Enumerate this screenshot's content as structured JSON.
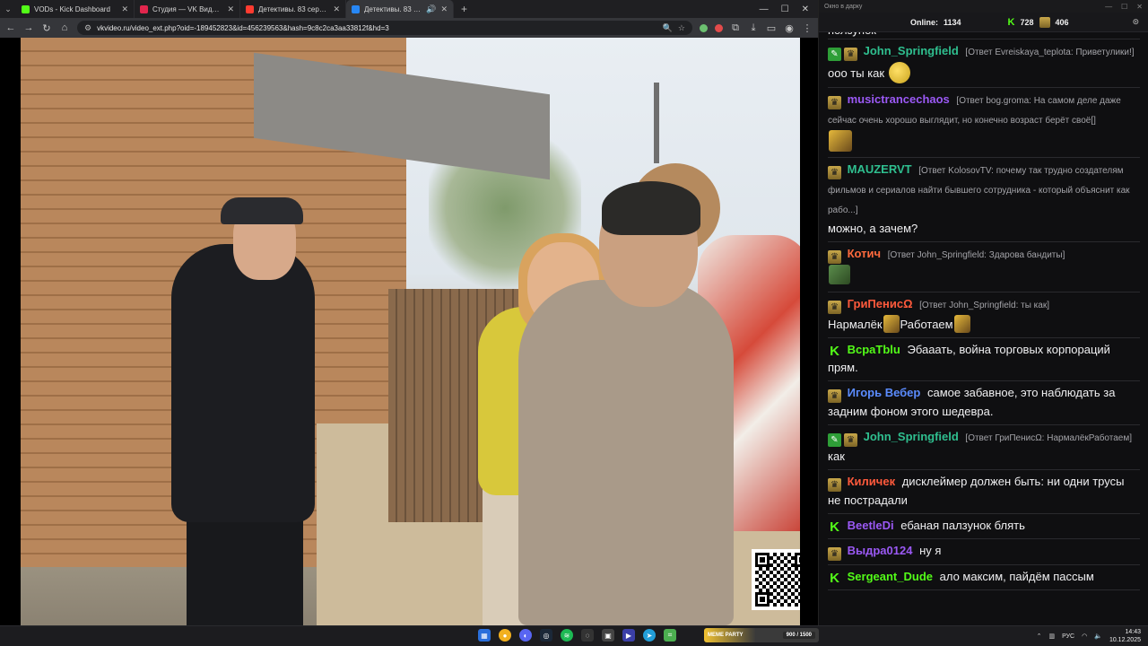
{
  "browser": {
    "tabs": [
      {
        "title": "VODs - Kick Dashboard",
        "color": "#53fc18"
      },
      {
        "title": "Студия — VK Видео Live",
        "color": "#e2264d"
      },
      {
        "title": "Детективы. 83 серия. Мужско...",
        "color": "#ff3b30"
      },
      {
        "title": "Детективы. 83 серия. Мужс",
        "color": "#2787f5"
      }
    ],
    "url": "vkvideo.ru/video_ext.php?oid=-189452823&id=456239563&hash=9c8c2ca3aa33812f&hd=3"
  },
  "chat": {
    "window_title": "Окно в дарку",
    "online_label": "Online:",
    "online_value": "1134",
    "kick_count": "728",
    "vk_count": "406",
    "partial_top": "ползунок",
    "messages": [
      {
        "user": "John_Springfield",
        "color": "#2fbf8f",
        "badges": [
          "pencil",
          "gold"
        ],
        "reply": "[Ответ Evreiskaya_teplota: Приветулики!]",
        "text": "ооо ты как",
        "emote": "face"
      },
      {
        "user": "musictrancechaos",
        "color": "#9b59f5",
        "badges": [
          "gold"
        ],
        "reply": "[Ответ bog.groma: На самом деле даже сейчас очень хорошо выглядит, но конечно возраст берёт своё[]",
        "text": "",
        "emote": "gold-line"
      },
      {
        "user": "MAUZERVT",
        "color": "#2fbf8f",
        "badges": [
          "gold"
        ],
        "reply": "[Ответ KolosovTV: почему так трудно создателям фильмов и сериалов найти бывшего сотрудника - который объяснит как рабо...]",
        "text": "можно, а зачем?",
        "emote": ""
      },
      {
        "user": "Котич",
        "color": "#ff6a3d",
        "badges": [
          "gold"
        ],
        "reply": "[Ответ John_Springfield: Здарова бандиты]",
        "text": "",
        "emote": "green-line"
      },
      {
        "user": "ГриПенисΩ",
        "color": "#ff5a3c",
        "badges": [
          "gold"
        ],
        "reply": "[Ответ John_Springfield: ты как]",
        "text_a": "Нармалёк",
        "text_b": "Работаем",
        "emote": "inline2"
      },
      {
        "user": "ВсраТblu",
        "color": "#53fc18",
        "badges": [
          "k"
        ],
        "reply": "",
        "text": "Эбааать, война торговых корпораций прям.",
        "emote": ""
      },
      {
        "user": "Игорь Вебер",
        "color": "#5b8cff",
        "badges": [
          "gold"
        ],
        "reply": "",
        "text": "самое забавное, это наблюдать за задним фоном этого шедевра.",
        "emote": ""
      },
      {
        "user": "John_Springfield",
        "color": "#2fbf8f",
        "badges": [
          "pencil",
          "gold"
        ],
        "reply": "[Ответ ГриПенисΩ: НармалёкРаботаем]",
        "text": "как",
        "emote": ""
      },
      {
        "user": "Киличек",
        "color": "#ff5a3c",
        "badges": [
          "gold"
        ],
        "reply": "",
        "text": "дисклеймер должен быть: ни одни трусы не пострадали",
        "emote": ""
      },
      {
        "user": "BeetleDi",
        "color": "#9b59f5",
        "badges": [
          "k"
        ],
        "reply": "",
        "text": "ебаная палзунок блять",
        "emote": ""
      },
      {
        "user": "Выдра0124",
        "color": "#9b59f5",
        "badges": [
          "gold"
        ],
        "reply": "",
        "text": "ну я",
        "emote": ""
      },
      {
        "user": "Sergeant_Dude",
        "color": "#53fc18",
        "badges": [
          "k"
        ],
        "reply": "",
        "text": "ало максим, пайдём пассым",
        "emote": ""
      }
    ]
  },
  "taskbar": {
    "widget_label": "MEME PARTY",
    "widget_count": "900 / 1500",
    "lang": "РУС",
    "time": "14:43",
    "date": "10.12.2025"
  }
}
